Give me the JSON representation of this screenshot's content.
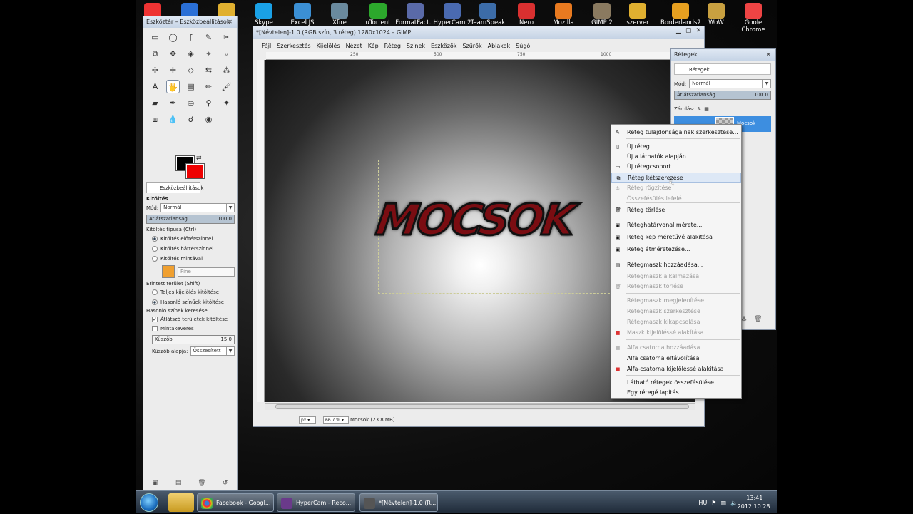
{
  "desktop": {
    "icons": [
      {
        "label": "",
        "color": "#e33"
      },
      {
        "label": "",
        "color": "#2a6fd6"
      },
      {
        "label": "",
        "color": "#e0b030"
      },
      {
        "label": "Skype",
        "color": "#1aa1e6"
      },
      {
        "label": "Excel JS",
        "color": "#3b8fd4"
      },
      {
        "label": "Xfire",
        "color": "#6a8a9e"
      },
      {
        "label": "uTorrent",
        "color": "#2ca82c"
      },
      {
        "label": "FormatFact...",
        "color": "#5a6aa8"
      },
      {
        "label": "HyperCam 2",
        "color": "#4a6ab0"
      },
      {
        "label": "TeamSpeak 3...",
        "color": "#3c6ca8"
      },
      {
        "label": "Nero",
        "color": "#d93030"
      },
      {
        "label": "Mozilla",
        "color": "#e87a20"
      },
      {
        "label": "GIMP 2",
        "color": "#8a7a60"
      },
      {
        "label": "szerver",
        "color": "#e0b030"
      },
      {
        "label": "Borderlands2",
        "color": "#e7a020"
      },
      {
        "label": "WoW",
        "color": "#c8a040"
      },
      {
        "label": "Goole Chrome",
        "color": "#e44"
      }
    ]
  },
  "toolbox": {
    "title": "Eszköztár – Eszközbeállítások",
    "tools": [
      "▭",
      "◯",
      "ʃ",
      "✎",
      "✂",
      "⧉",
      "✥",
      "◈",
      "⌖",
      "⌕",
      "✢",
      "✛",
      "◇",
      "⇆",
      "⁂",
      "A",
      "🖐",
      "▤",
      "✏",
      "🖌",
      "▰",
      "✒",
      "⛀",
      "⚲",
      "✦",
      "⧈",
      "💧",
      "☌",
      "◉",
      ""
    ],
    "options_tab": "Eszközbeállítások",
    "heading": "Kitöltés",
    "mode_label": "Mód:",
    "mode_value": "Normál",
    "opacity_label": "Átlátszatlanság",
    "opacity_value": "100.0",
    "fill_type_label": "Kitöltés típusa  (Ctrl)",
    "fill_fg": "Kitöltés előtérszínnel",
    "fill_bg": "Kitöltés háttérszínnel",
    "fill_pattern": "Kitöltés mintával",
    "pattern_name": "Pine",
    "affected_label": "Érintett terület  (Shift)",
    "affected_all": "Teljes kijelölés kitöltése",
    "affected_similar": "Hasonló színűek kitöltése",
    "similar_label": "Hasonló színek keresése",
    "fill_transparent": "Átlátszó területek kitöltése",
    "sample_merged": "Mintakeverés",
    "threshold_label": "Küszöb",
    "threshold_value": "15.0",
    "threshold_basis_label": "Küszöb alapja:",
    "threshold_basis_value": "Összesített"
  },
  "image_window": {
    "title": "*[Névtelen]-1.0 (RGB szín, 3 réteg) 1280x1024 – GIMP",
    "menus": [
      "Fájl",
      "Szerkesztés",
      "Kijelölés",
      "Nézet",
      "Kép",
      "Réteg",
      "Színek",
      "Eszközök",
      "Szűrők",
      "Ablakok",
      "Súgó"
    ],
    "ruler_labels": [
      "250",
      "500",
      "750",
      "1000"
    ],
    "canvas_text": "MOCSOK",
    "unit": "px",
    "zoom": "66.7 %",
    "status": "Mocsok (23.8 MB)"
  },
  "layers": {
    "title": "Rétegek",
    "tab": "Rétegek",
    "mode_label": "Mód:",
    "mode_value": "Normál",
    "opacity_label": "Átlátszatlanság",
    "opacity_value": "100.0",
    "lock_label": "Zárolás:",
    "selected_layer": "Mocsok"
  },
  "context_menu": {
    "items": [
      {
        "label": "Réteg tulajdonságainak szerkesztése...",
        "enabled": true,
        "icon": "✎"
      },
      {
        "label": "Új réteg...",
        "enabled": true,
        "icon": "▯"
      },
      {
        "label": "Új a láthatók alapján",
        "enabled": true,
        "icon": ""
      },
      {
        "label": "Új rétegcsoport...",
        "enabled": true,
        "icon": "▭"
      },
      {
        "label": "Réteg kétszerezése",
        "enabled": true,
        "icon": "⧉",
        "hover": true
      },
      {
        "label": "Réteg rögzítése",
        "enabled": false,
        "icon": "⚓"
      },
      {
        "label": "Összefésülés lefelé",
        "enabled": false,
        "icon": ""
      },
      {
        "label": "Réteg törlése",
        "enabled": true,
        "icon": "🗑"
      },
      {
        "label": "Réteghatárvonal mérete...",
        "enabled": true,
        "icon": "▣"
      },
      {
        "label": "Réteg kép méretűvé alakítása",
        "enabled": true,
        "icon": "▣"
      },
      {
        "label": "Réteg átméretezése...",
        "enabled": true,
        "icon": "▣"
      },
      {
        "label": "Rétegmaszk hozzáadása...",
        "enabled": true,
        "icon": "▤"
      },
      {
        "label": "Rétegmaszk alkalmazása",
        "enabled": false,
        "icon": ""
      },
      {
        "label": "Rétegmaszk törlése",
        "enabled": false,
        "icon": "🗑"
      },
      {
        "label": "Rétegmaszk megjelenítése",
        "enabled": false,
        "icon": ""
      },
      {
        "label": "Rétegmaszk szerkesztése",
        "enabled": false,
        "icon": ""
      },
      {
        "label": "Rétegmaszk kikapcsolása",
        "enabled": false,
        "icon": ""
      },
      {
        "label": "Maszk kijelöléssé alakítása",
        "enabled": false,
        "icon": "■"
      },
      {
        "label": "Alfa csatorna hozzáadása",
        "enabled": false,
        "icon": "▦"
      },
      {
        "label": "Alfa csatorna eltávolítása",
        "enabled": true,
        "icon": ""
      },
      {
        "label": "Alfa-csatorna kijelöléssé alakítása",
        "enabled": true,
        "icon": "■"
      },
      {
        "label": "Látható rétegek összefésülése...",
        "enabled": true,
        "icon": ""
      },
      {
        "label": "Egy rétegé lapítás",
        "enabled": true,
        "icon": ""
      }
    ]
  },
  "taskbar": {
    "windows": [
      "Facebook - Googl...",
      "HyperCam - Reco...",
      "*[Névtelen]-1.0 (R..."
    ],
    "lang": "HU",
    "time": "13:41",
    "date": "2012.10.28."
  }
}
